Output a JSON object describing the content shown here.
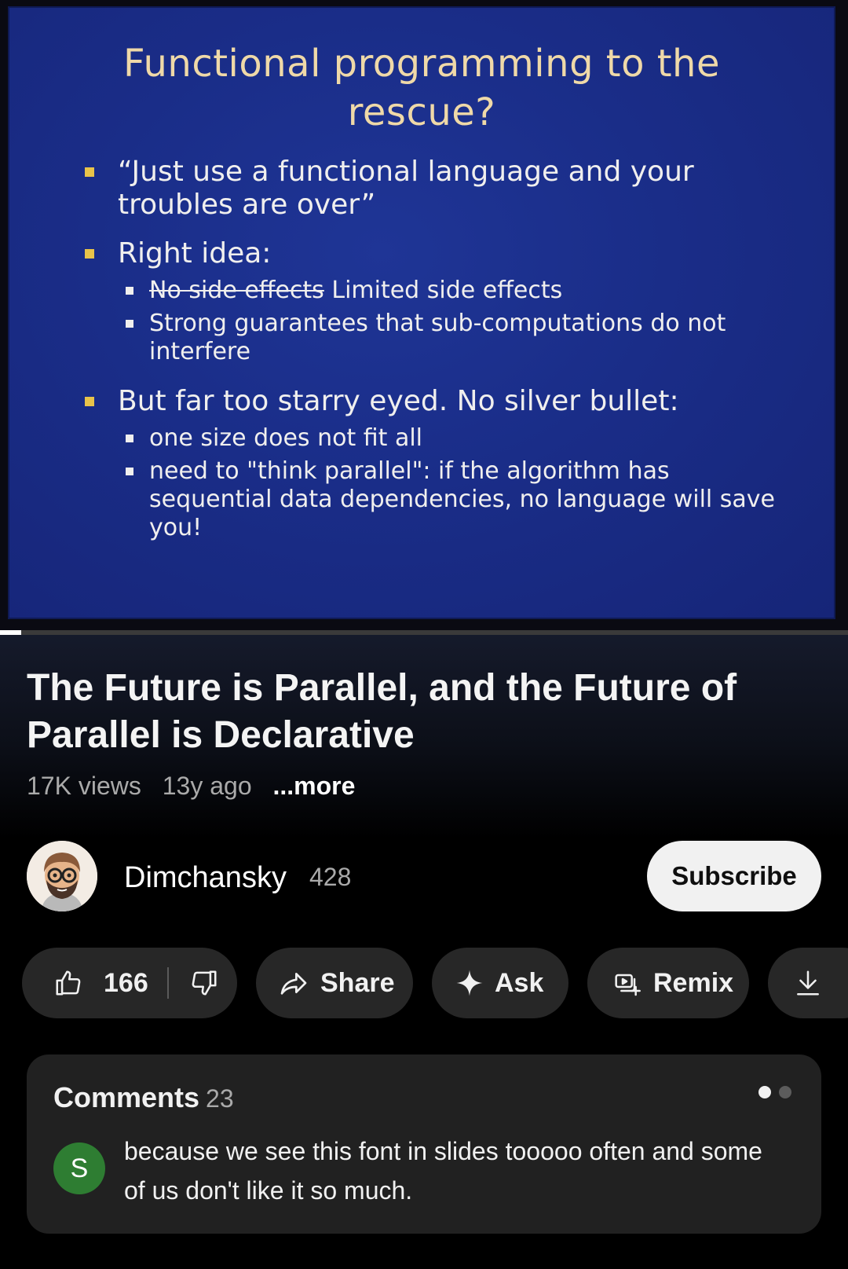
{
  "video": {
    "slide": {
      "title_line1": "Functional programming to the",
      "title_line2": "rescue?",
      "bullets": [
        {
          "text": "“Just use a functional language and your troubles are over”"
        },
        {
          "text": "Right idea:"
        },
        {
          "sub_struck": "No side effects",
          "sub_rest": " Limited side effects"
        },
        {
          "sub": "Strong guarantees that sub-computations do not interfere"
        },
        {
          "text": "But far too starry eyed.  No silver bullet:"
        },
        {
          "sub": "one size does not fit all"
        },
        {
          "sub": "need to \"think parallel\": if the algorithm has sequential data dependencies, no language will save you!"
        }
      ]
    },
    "progress_fraction": 0.025
  },
  "info": {
    "title": "The Future is Parallel, and the Future of Parallel is Declarative",
    "views": "17K views",
    "age": "13y ago",
    "more": "...more"
  },
  "channel": {
    "name": "Dimchansky",
    "subscribers": "428",
    "subscribe_label": "Subscribe"
  },
  "actions": {
    "like_count": "166",
    "share_label": "Share",
    "ask_label": "Ask",
    "remix_label": "Remix"
  },
  "comments": {
    "heading": "Comments",
    "count": "23",
    "top_comment": {
      "avatar_letter": "S",
      "avatar_color": "#2e7d32",
      "text": "because we see this font in slides tooooo often and some of us don't like it so much."
    }
  },
  "icons": [
    "like-icon",
    "dislike-icon",
    "share-icon",
    "sparkle-icon",
    "remix-icon",
    "download-icon"
  ]
}
